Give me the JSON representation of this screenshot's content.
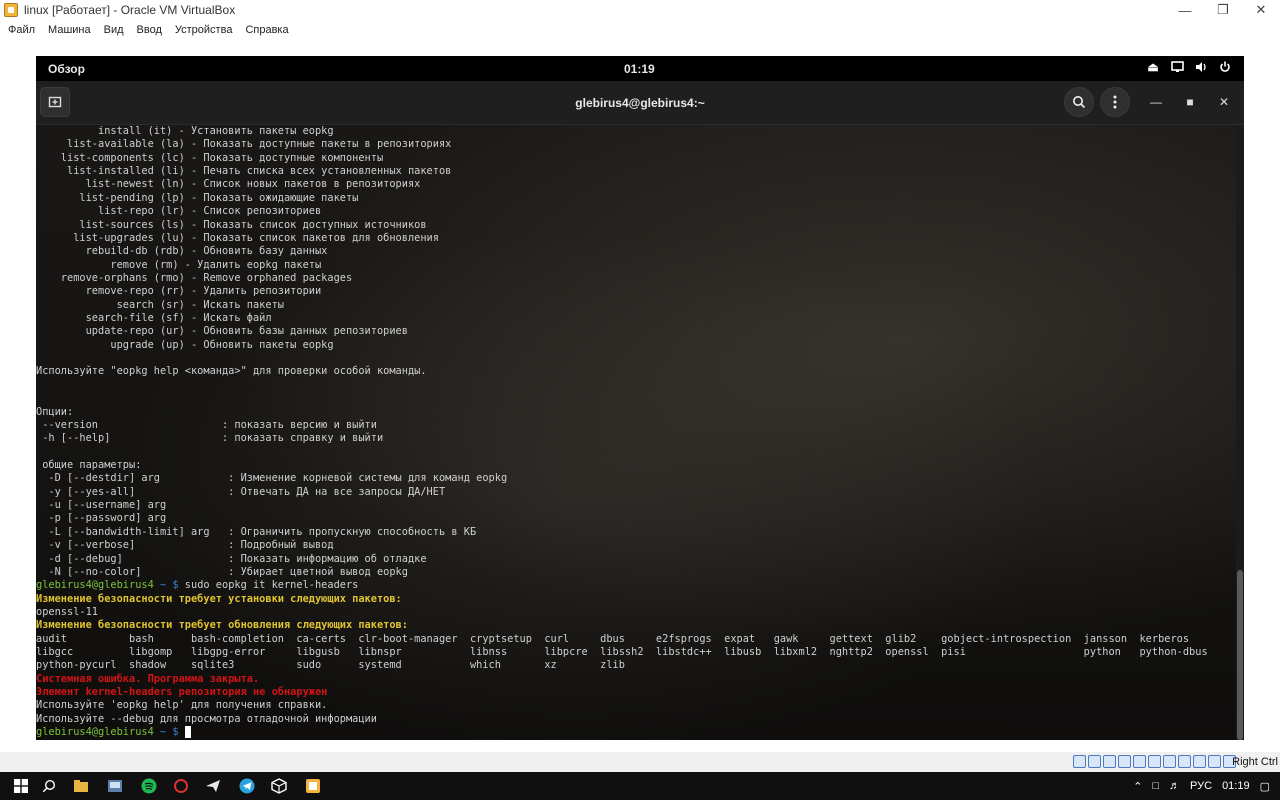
{
  "host": {
    "title": "linux [Работает] - Oracle VM VirtualBox",
    "menu": [
      "Файл",
      "Машина",
      "Вид",
      "Ввод",
      "Устройства",
      "Справка"
    ],
    "host_key": "Right Ctrl"
  },
  "guest": {
    "topbar": {
      "overview": "Обзор",
      "clock": "01:19"
    },
    "terminal_title": "glebirus4@glebirus4:~",
    "lines": [
      {
        "t": "          install (it) - Установить пакеты eopkg"
      },
      {
        "t": "     list-available (la) - Показать доступные пакеты в репозиториях"
      },
      {
        "t": "    list-components (lc) - Показать доступные компоненты"
      },
      {
        "t": "     list-installed (li) - Печать списка всех установленных пакетов"
      },
      {
        "t": "        list-newest (ln) - Список новых пакетов в репозиториях"
      },
      {
        "t": "       list-pending (lp) - Показать ожидающие пакеты"
      },
      {
        "t": "          list-repo (lr) - Список репозиториев"
      },
      {
        "t": "       list-sources (ls) - Показать список доступных источников"
      },
      {
        "t": "      list-upgrades (lu) - Показать список пакетов для обновления"
      },
      {
        "t": "        rebuild-db (rdb) - Обновить базу данных"
      },
      {
        "t": "            remove (rm) - Удалить eopkg пакеты"
      },
      {
        "t": "    remove-orphans (rmo) - Remove orphaned packages"
      },
      {
        "t": "        remove-repo (rr) - Удалить репозитории"
      },
      {
        "t": "             search (sr) - Искать пакеты"
      },
      {
        "t": "        search-file (sf) - Искать файл"
      },
      {
        "t": "        update-repo (ur) - Обновить базы данных репозиториев"
      },
      {
        "t": "            upgrade (up) - Обновить пакеты eopkg"
      },
      {
        "t": ""
      },
      {
        "t": "Используйте \"eopkg help <команда>\" для проверки особой команды."
      },
      {
        "t": ""
      },
      {
        "t": ""
      },
      {
        "t": "Опции:"
      },
      {
        "t": " --version                    : показать версию и выйти"
      },
      {
        "t": " -h [--help]                  : показать справку и выйти"
      },
      {
        "t": ""
      },
      {
        "t": " общие параметры:"
      },
      {
        "t": "  -D [--destdir] arg           : Изменение корневой системы для команд eopkg"
      },
      {
        "t": "  -y [--yes-all]               : Отвечать ДА на все запросы ДА/НЕТ"
      },
      {
        "t": "  -u [--username] arg"
      },
      {
        "t": "  -p [--password] arg"
      },
      {
        "t": "  -L [--bandwidth-limit] arg   : Ограничить пропускную способность в КБ"
      },
      {
        "t": "  -v [--verbose]               : Подробный вывод"
      },
      {
        "t": "  -d [--debug]                 : Показать информацию об отладке"
      },
      {
        "t": "  -N [--no-color]              : Убирает цветной вывод eopkg"
      },
      {
        "t": "",
        "prompt": true,
        "cmd": "sudo eopkg it kernel-headers"
      },
      {
        "t": "Изменение безопасности требует установки следующих пакетов:",
        "c": "warn"
      },
      {
        "t": "openssl-11"
      },
      {
        "t": "Изменение безопасности требует обновления следующих пакетов:",
        "c": "warn"
      },
      {
        "t": "audit          bash      bash-completion  ca-certs  clr-boot-manager  cryptsetup  curl     dbus     e2fsprogs  expat   gawk     gettext  glib2    gobject-introspection  jansson  kerberos"
      },
      {
        "t": "libgcc         libgomp   libgpg-error     libgusb   libnspr           libnss      libpcre  libssh2  libstdc++  libusb  libxml2  nghttp2  openssl  pisi                   python   python-dbus"
      },
      {
        "t": "python-pycurl  shadow    sqlite3          sudo      systemd           which       xz       zlib"
      },
      {
        "t": "Системная ошибка. Программа закрыта.",
        "c": "err"
      },
      {
        "t": "Элемент kernel-headers репозитория не обнаружен",
        "c": "err"
      },
      {
        "t": "Используйте 'eopkg help' для получения справки."
      },
      {
        "t": "Используйте --debug для просмотра отладочной информации"
      },
      {
        "t": "",
        "prompt": true,
        "cmd": "",
        "cursor": true
      }
    ],
    "prompt_user": "glebirus4@glebirus4",
    "prompt_tail": " ~ $ "
  },
  "taskbar": {
    "lang": "РУС",
    "time": "01:19"
  }
}
